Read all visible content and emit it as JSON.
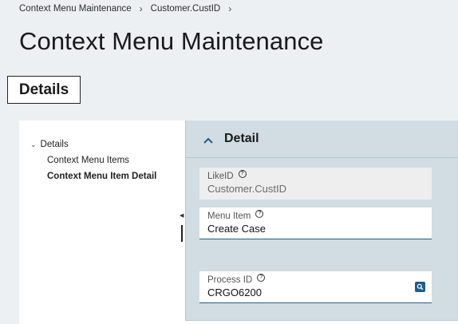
{
  "breadcrumb": {
    "items": [
      "Context Menu Maintenance",
      "Customer.CustID"
    ],
    "separator": "›"
  },
  "page": {
    "title": "Context Menu Maintenance"
  },
  "tab": {
    "label": "Details"
  },
  "tree": {
    "root_label": "Details",
    "items": [
      {
        "label": "Context Menu Items",
        "selected": false
      },
      {
        "label": "Context Menu Item Detail",
        "selected": true
      }
    ]
  },
  "panel": {
    "title": "Detail",
    "fields": {
      "like_id": {
        "label": "LikeID",
        "value": "Customer.CustID",
        "readonly": true
      },
      "menu_item": {
        "label": "Menu Item",
        "value": "Create Case",
        "readonly": false
      },
      "process_id": {
        "label": "Process ID",
        "value": "CRGO6200",
        "readonly": false
      }
    }
  },
  "icons": {
    "help": "help-circle-icon",
    "lookup": "search-lookup-icon",
    "collapse": "chevron-up-icon",
    "expand": "chevron-down-icon"
  },
  "colors": {
    "background": "#edf0f3",
    "panel": "#d1dde3",
    "accent": "#1f5d8a"
  }
}
